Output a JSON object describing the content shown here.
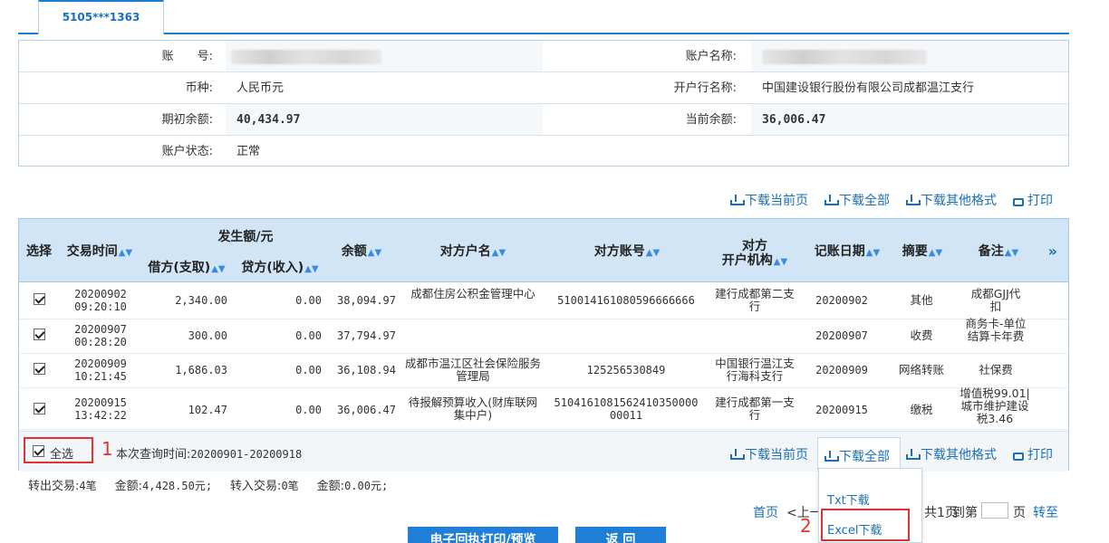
{
  "tab": {
    "label": "5105***1363"
  },
  "account": {
    "account_no_label": "账　　号:",
    "currency_label": "币种:",
    "currency_value": "人民币元",
    "opening_balance_label": "期初余额:",
    "opening_balance_value": "40,434.97",
    "status_label": "账户状态:",
    "status_value": "正常",
    "account_name_label": "账户名称:",
    "bank_label": "开户行名称:",
    "bank_value": "中国建设银行股份有限公司成都温江支行",
    "current_balance_label": "当前余额:",
    "current_balance_value": "36,006.47"
  },
  "actions": {
    "download_current": "下载当前页",
    "download_all": "下载全部",
    "download_other": "下载其他格式",
    "print": "打印"
  },
  "table": {
    "headers": {
      "select": "选择",
      "time": "交易时间",
      "amount_group": "发生额/元",
      "debit": "借方(支取)",
      "credit": "贷方(收入)",
      "balance": "余额",
      "counter_name": "对方户名",
      "counter_account": "对方账号",
      "counter_bank": "对方\n开户机构",
      "record_date": "记账日期",
      "summary": "摘要",
      "remark": "备注",
      "more": "»"
    },
    "rows": [
      {
        "date": "20200902",
        "time": "09:20:10",
        "debit": "2,340.00",
        "credit": "0.00",
        "balance": "38,094.97",
        "counter_name": "成都住房公积金管理中心",
        "counter_account": "510014161080596666666",
        "counter_bank": "建行成都第二支行",
        "record_date": "20200902",
        "summary": "其他",
        "remark": "成都GJJ代扣"
      },
      {
        "date": "20200907",
        "time": "00:28:20",
        "debit": "300.00",
        "credit": "0.00",
        "balance": "37,794.97",
        "counter_name": "",
        "counter_account": "",
        "counter_bank": "",
        "record_date": "20200907",
        "summary": "收费",
        "remark": "商务卡-单位结算卡年费"
      },
      {
        "date": "20200909",
        "time": "10:21:45",
        "debit": "1,686.03",
        "credit": "0.00",
        "balance": "36,108.94",
        "counter_name": "成都市温江区社会保险服务管理局",
        "counter_account": "125256530849",
        "counter_bank": "中国银行温江支行海科支行",
        "record_date": "20200909",
        "summary": "网络转账",
        "remark": "社保费"
      },
      {
        "date": "20200915",
        "time": "13:42:22",
        "debit": "102.47",
        "credit": "0.00",
        "balance": "36,006.47",
        "counter_name": "待报解预算收入(财库联网集中户)",
        "counter_account": "510416108156241035000000011",
        "counter_bank": "建行成都第一支行",
        "record_date": "20200915",
        "summary": "缴税",
        "remark": "增值税99.01|城市维护建设税3.46"
      }
    ]
  },
  "footer": {
    "select_all": "全选",
    "query_time_label": "本次查询时间:",
    "query_time_value": "20200901-20200918",
    "out_label": "转出交易:",
    "out_value": "4笔",
    "out_amount_label": "金额:",
    "out_amount_value": "4,428.50元;",
    "in_label": "转入交易:",
    "in_value": "0笔",
    "in_amount_label": "金额:",
    "in_amount_value": "0.00元;"
  },
  "annotations": {
    "marker1": "1",
    "marker2": "2"
  },
  "dropdown": {
    "txt": "Txt下载",
    "excel": "Excel下载"
  },
  "pager": {
    "first": "首页",
    "prev": "<上一",
    "page_info": "共1页",
    "goto_label": "到第",
    "page_unit": "页",
    "goto_btn": "转至"
  },
  "buttons": {
    "print_preview": "电子回执打印/预览",
    "back": "返 回"
  }
}
